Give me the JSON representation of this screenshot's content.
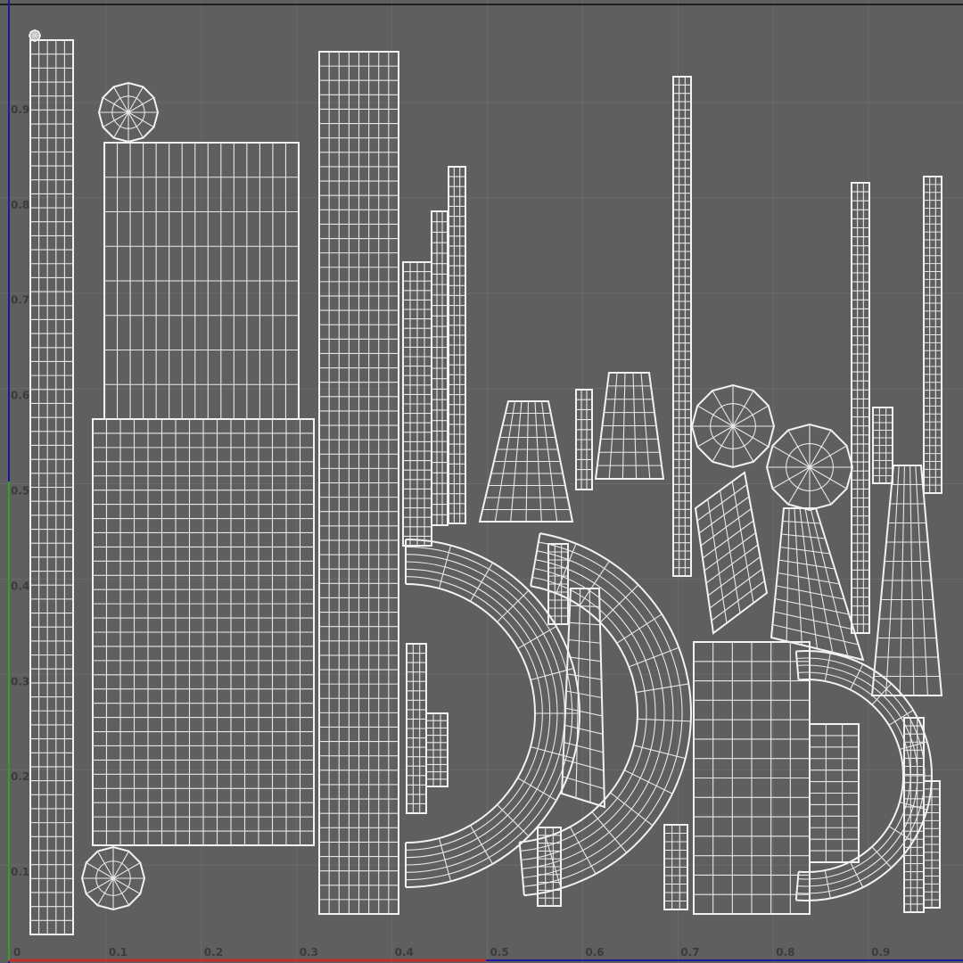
{
  "viewport": {
    "name": "UV Editor",
    "background": "#5f5f5f",
    "grid_color": "#6a6a6a",
    "wire_color": "#e8e8e8",
    "u_axis_color": "#c0302a",
    "v_axis_color": "#2fa02a",
    "frame_color": "#1a1aa0"
  },
  "u_ticks": [
    "0",
    "0.1",
    "0.2",
    "0.3",
    "0.4",
    "0.5",
    "0.6",
    "0.7",
    "0.8",
    "0.9"
  ],
  "v_ticks": [
    "0.9",
    "0.8",
    "0.7",
    "0.6",
    "0.5",
    "0.4",
    "0.3",
    "0.2",
    "0.1"
  ],
  "shells": {
    "icons": [
      "cylinder-strip",
      "cap-disc",
      "body-sleeve",
      "curved-band",
      "tapered-cup"
    ]
  }
}
